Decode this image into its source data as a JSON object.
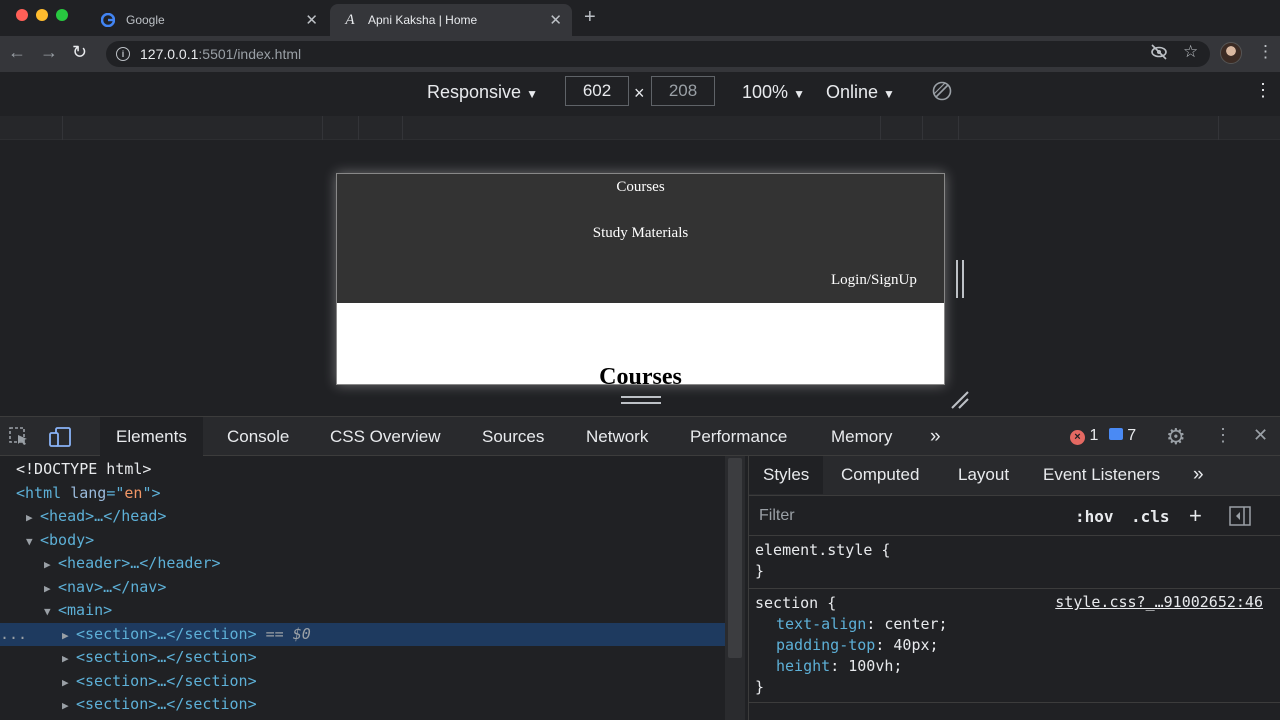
{
  "browser": {
    "tabs": [
      {
        "title": "Google",
        "active": false
      },
      {
        "title": "Apni Kaksha | Home",
        "active": true
      }
    ],
    "url_host": "127.0.0.1",
    "url_path": ":5501/index.html"
  },
  "device_toolbar": {
    "device": "Responsive",
    "width": "602",
    "height": "208",
    "zoom": "100%",
    "throttling": "Online",
    "times": "×"
  },
  "emulated_page": {
    "links": [
      "Courses",
      "Study Materials",
      "Login/SignUp"
    ],
    "heading": "Courses"
  },
  "devtools": {
    "tabs": [
      "Elements",
      "Console",
      "CSS Overview",
      "Sources",
      "Network",
      "Performance",
      "Memory"
    ],
    "more": "»",
    "error_count": "1",
    "message_count": "7",
    "dom_lines": [
      {
        "indent": 0,
        "arrow": "",
        "text": "<!DOCTYPE html>"
      },
      {
        "indent": 0,
        "arrow": "",
        "open": "<html ",
        "attr": "lang",
        "eq": "=\"",
        "value": "en",
        "close": "\">"
      },
      {
        "indent": 1,
        "arrow": "▶",
        "text": "<head>…</head>"
      },
      {
        "indent": 1,
        "arrow": "▼",
        "text": "<body>"
      },
      {
        "indent": 2,
        "arrow": "▶",
        "text": "<header>…</header>"
      },
      {
        "indent": 2,
        "arrow": "▶",
        "text": "<nav>…</nav>"
      },
      {
        "indent": 2,
        "arrow": "▼",
        "text": "<main>"
      },
      {
        "indent": 3,
        "arrow": "▶",
        "text": "<section>…</section>",
        "suffix": " == $0",
        "selected": true
      },
      {
        "indent": 3,
        "arrow": "▶",
        "text": "<section>…</section>"
      },
      {
        "indent": 3,
        "arrow": "▶",
        "text": "<section>…</section>"
      },
      {
        "indent": 3,
        "arrow": "▶",
        "text": "<section>…</section>"
      }
    ],
    "ellipsis": "...",
    "styles": {
      "tabs": [
        "Styles",
        "Computed",
        "Layout",
        "Event Listeners"
      ],
      "more": "»",
      "filter_placeholder": "Filter",
      "hov": ":hov",
      "cls": ".cls",
      "plus": "+",
      "element_style_open": "element.style {",
      "element_style_close": "}",
      "rule_selector": "section {",
      "rule_source": "style.css?_…91002652:46",
      "rule_props": [
        {
          "prop": "text-align",
          "value": "center;"
        },
        {
          "prop": "padding-top",
          "value": "40px;"
        },
        {
          "prop": "height",
          "value": "100vh;"
        }
      ],
      "rule_close": "}"
    }
  }
}
